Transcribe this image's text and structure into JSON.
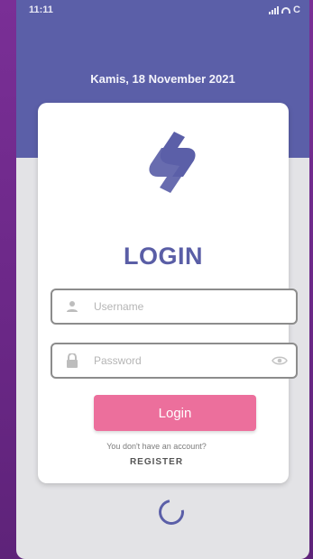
{
  "status_bar": {
    "time": "11:11",
    "battery": "C"
  },
  "header": {
    "date": "Kamis, 18 November 2021"
  },
  "login": {
    "title": "LOGIN",
    "username_placeholder": "Username",
    "password_placeholder": "Password",
    "login_button_label": "Login",
    "no_account_text": "You don't have an account?",
    "register_label": "REGISTER"
  },
  "colors": {
    "brand": "#5b5fa8",
    "button": "#ec6f9c",
    "background": "#6e2a8a"
  },
  "icons": {
    "username": "user-icon",
    "password": "lock-icon",
    "toggle": "eye-icon",
    "loading": "spinner-icon",
    "logo": "app-logo"
  }
}
